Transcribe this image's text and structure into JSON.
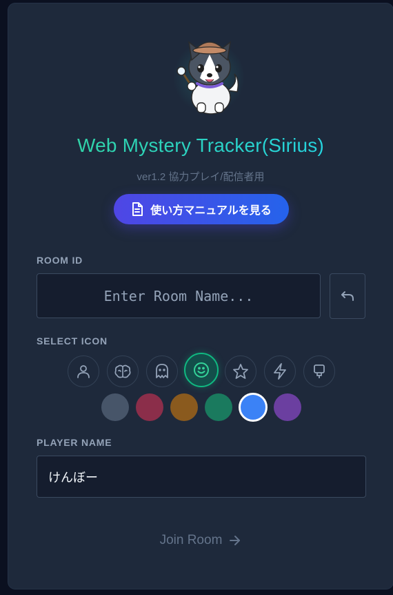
{
  "app": {
    "title": "Web Mystery Tracker(Sirius)",
    "version": "ver1.2 協力プレイ/配信者用",
    "manual_button": "使い方マニュアルを見る"
  },
  "room": {
    "label": "ROOM ID",
    "placeholder": "Enter Room Name...",
    "value": ""
  },
  "icons": {
    "label": "SELECT ICON",
    "items": [
      {
        "name": "user-icon",
        "selected": false
      },
      {
        "name": "brain-icon",
        "selected": false
      },
      {
        "name": "ghost-icon",
        "selected": false
      },
      {
        "name": "smile-icon",
        "selected": true
      },
      {
        "name": "star-icon",
        "selected": false
      },
      {
        "name": "zap-icon",
        "selected": false
      },
      {
        "name": "stamp-icon",
        "selected": false
      }
    ]
  },
  "colors": {
    "items": [
      "#475569",
      "#8b2e4a",
      "#8a5a1e",
      "#1a7a5e",
      "#3b82f6",
      "#6b3fa0"
    ],
    "selected": "#3b82f6"
  },
  "player": {
    "label": "PLAYER NAME",
    "value": "けんぼー"
  },
  "join": {
    "label": "Join Room"
  },
  "theme": {
    "accent": "#10b981",
    "button_gradient_start": "#4f46e5",
    "button_gradient_end": "#2563eb"
  }
}
